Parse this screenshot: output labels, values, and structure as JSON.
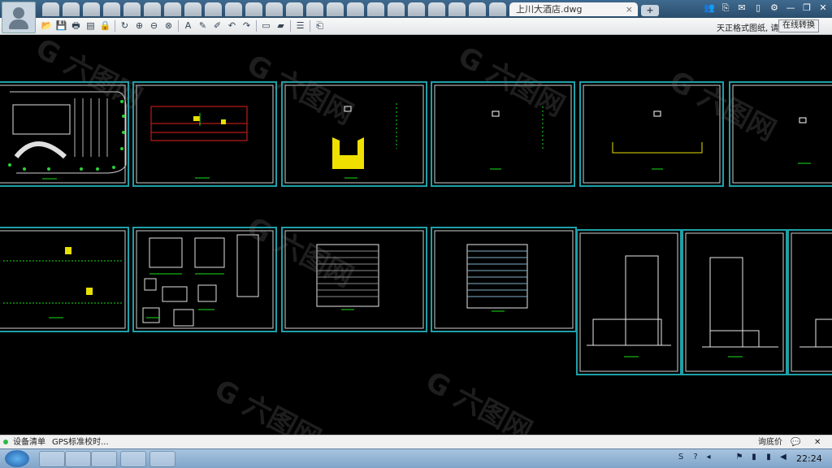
{
  "window": {
    "active_tab": "上川大酒店.dwg",
    "tab_close": "×",
    "new_tab": "+",
    "controls": [
      "👥",
      "⎘",
      "✉",
      "▯",
      "⚙",
      "—",
      "❐",
      "✕"
    ]
  },
  "toolbar": {
    "notice": "天正格式图纸, 请",
    "convert_label": "在线转换",
    "tools": [
      "📂",
      "💾",
      "🖶",
      "▤",
      "🔒",
      "|",
      "↻",
      "⊕",
      "⊖",
      "⊗",
      "|",
      "A",
      "✎",
      "✐",
      "↶",
      "↷",
      "|",
      "▭",
      "▰",
      "|",
      "☰",
      "|",
      "⎗"
    ]
  },
  "status": {
    "device_list": "设备清单",
    "gps": "GPS标准校时...",
    "ask_price": "询底价",
    "chat": "💬",
    "close": "✕"
  },
  "taskbar": {
    "clock": "22:24",
    "tray": [
      "S",
      "?",
      "◂",
      "⚑",
      "▮",
      "▮",
      "◀"
    ]
  },
  "drawing": {
    "accent": "#1fa0a8",
    "watermark": "G 六图网"
  }
}
